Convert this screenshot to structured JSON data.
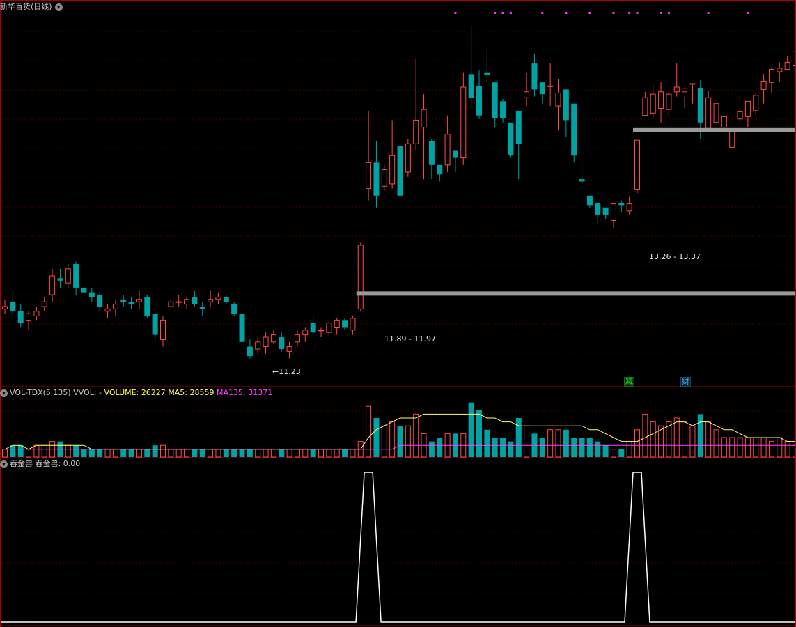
{
  "title": "新华百货(日线)",
  "vol_header": {
    "name": "VOL-TDX(5,135)",
    "vvol": "VVOL: -",
    "volume": "VOLUME: 26227",
    "ma5": "MA5: 28559",
    "ma135": "MA135: 31371"
  },
  "ind_header": {
    "name": "吞金兽",
    "value": "吞金兽: 0.00"
  },
  "annotations": {
    "low": "←11.23",
    "zone1": "11.89 - 11.97",
    "zone2": "13.26 - 13.37",
    "tag_green": "减",
    "tag_blue": "财"
  },
  "colors": {
    "up": "#ff4a4a",
    "down": "#00a3a3",
    "ma5": "#ffff66",
    "ma135": "#ff40ff",
    "indicator": "#ffffff",
    "zone": "#9a9a9a",
    "dots": "#ff33ff",
    "tag_green": "#22dd22",
    "tag_blue": "#33bbff"
  },
  "chart_data": {
    "type": "candlestick",
    "series": [
      {
        "name": "price",
        "ohlc": [
          [
            11.8,
            11.88,
            11.76,
            11.82
          ],
          [
            11.86,
            11.95,
            11.74,
            11.78
          ],
          [
            11.78,
            11.84,
            11.64,
            11.68
          ],
          [
            11.7,
            11.78,
            11.62,
            11.76
          ],
          [
            11.74,
            11.82,
            11.7,
            11.78
          ],
          [
            11.82,
            11.9,
            11.78,
            11.86
          ],
          [
            11.92,
            12.14,
            11.86,
            12.08
          ],
          [
            12.06,
            12.14,
            11.98,
            12.04
          ],
          [
            12.02,
            12.18,
            11.98,
            12.14
          ],
          [
            12.18,
            12.2,
            11.92,
            11.98
          ],
          [
            11.98,
            12.0,
            11.92,
            11.94
          ],
          [
            11.94,
            11.98,
            11.86,
            11.9
          ],
          [
            11.92,
            11.94,
            11.78,
            11.82
          ],
          [
            11.78,
            11.84,
            11.72,
            11.8
          ],
          [
            11.8,
            11.88,
            11.74,
            11.84
          ],
          [
            11.88,
            11.92,
            11.82,
            11.86
          ],
          [
            11.86,
            11.9,
            11.8,
            11.84
          ],
          [
            11.86,
            11.96,
            11.8,
            11.88
          ],
          [
            11.9,
            11.92,
            11.72,
            11.74
          ],
          [
            11.76,
            11.78,
            11.52,
            11.58
          ],
          [
            11.54,
            11.74,
            11.48,
            11.7
          ],
          [
            11.82,
            11.88,
            11.8,
            11.86
          ],
          [
            11.86,
            11.92,
            11.82,
            11.86
          ],
          [
            11.84,
            11.9,
            11.8,
            11.88
          ],
          [
            11.9,
            11.95,
            11.82,
            11.84
          ],
          [
            11.82,
            11.86,
            11.74,
            11.8
          ],
          [
            11.86,
            11.96,
            11.82,
            11.88
          ],
          [
            11.88,
            11.94,
            11.84,
            11.9
          ],
          [
            11.9,
            11.92,
            11.84,
            11.86
          ],
          [
            11.84,
            11.86,
            11.74,
            11.76
          ],
          [
            11.76,
            11.78,
            11.48,
            11.52
          ],
          [
            11.48,
            11.54,
            11.38,
            11.4
          ],
          [
            11.46,
            11.56,
            11.42,
            11.52
          ],
          [
            11.48,
            11.6,
            11.42,
            11.56
          ],
          [
            11.52,
            11.62,
            11.5,
            11.58
          ],
          [
            11.56,
            11.6,
            11.44,
            11.46
          ],
          [
            11.44,
            11.52,
            11.38,
            11.48
          ],
          [
            11.52,
            11.62,
            11.48,
            11.58
          ],
          [
            11.58,
            11.64,
            11.52,
            11.62
          ],
          [
            11.68,
            11.74,
            11.56,
            11.6
          ],
          [
            11.62,
            11.64,
            11.56,
            11.62
          ],
          [
            11.6,
            11.7,
            11.56,
            11.68
          ],
          [
            11.64,
            11.72,
            11.58,
            11.7
          ],
          [
            11.7,
            11.72,
            11.62,
            11.64
          ],
          [
            11.62,
            11.74,
            11.58,
            11.72
          ],
          [
            11.8,
            12.36,
            11.78,
            12.34
          ],
          [
            12.82,
            13.48,
            12.72,
            13.04
          ],
          [
            13.04,
            13.22,
            12.66,
            12.76
          ],
          [
            12.84,
            13.02,
            12.8,
            12.98
          ],
          [
            12.86,
            13.4,
            12.82,
            13.1
          ],
          [
            13.18,
            13.34,
            12.72,
            12.76
          ],
          [
            12.96,
            13.24,
            12.92,
            13.2
          ],
          [
            13.2,
            13.92,
            13.14,
            13.4
          ],
          [
            13.34,
            13.62,
            12.9,
            13.49
          ],
          [
            13.22,
            13.24,
            12.9,
            13.02
          ],
          [
            13.02,
            13.0,
            12.88,
            12.94
          ],
          [
            13.02,
            13.44,
            12.96,
            13.28
          ],
          [
            13.14,
            13.12,
            12.96,
            13.08
          ],
          [
            13.08,
            13.8,
            13.02,
            13.68
          ],
          [
            13.79,
            14.2,
            13.52,
            13.59
          ],
          [
            13.69,
            13.82,
            13.41,
            13.44
          ],
          [
            13.8,
            14.0,
            13.72,
            13.78
          ],
          [
            13.72,
            13.7,
            13.34,
            13.42
          ],
          [
            13.56,
            13.58,
            13.38,
            13.42
          ],
          [
            13.38,
            13.36,
            13.08,
            13.1
          ],
          [
            13.48,
            13.48,
            12.9,
            13.2
          ],
          [
            13.59,
            13.8,
            13.52,
            13.64
          ],
          [
            13.88,
            13.96,
            13.6,
            13.66
          ],
          [
            13.72,
            13.72,
            13.54,
            13.62
          ],
          [
            13.69,
            13.88,
            13.52,
            13.69
          ],
          [
            13.52,
            13.75,
            13.32,
            13.63
          ],
          [
            13.66,
            13.64,
            13.26,
            13.4
          ],
          [
            13.54,
            13.4,
            13.04,
            13.1
          ],
          [
            12.9,
            13.06,
            12.84,
            12.88
          ],
          [
            12.76,
            12.74,
            12.66,
            12.68
          ],
          [
            12.7,
            12.68,
            12.52,
            12.6
          ],
          [
            12.66,
            12.64,
            12.56,
            12.6
          ],
          [
            12.55,
            12.66,
            12.49,
            12.69
          ],
          [
            12.7,
            12.72,
            12.62,
            12.68
          ],
          [
            12.63,
            12.75,
            12.6,
            12.69
          ],
          [
            12.81,
            13.23,
            12.78,
            13.23
          ],
          [
            13.44,
            13.64,
            13.48,
            13.59
          ],
          [
            13.46,
            13.7,
            13.42,
            13.62
          ],
          [
            13.5,
            13.72,
            13.38,
            13.64
          ],
          [
            13.49,
            13.66,
            13.42,
            13.62
          ],
          [
            13.64,
            13.88,
            13.6,
            13.68
          ],
          [
            13.64,
            13.6,
            13.5,
            13.67
          ],
          [
            13.71,
            13.7,
            13.54,
            13.71
          ],
          [
            13.67,
            13.74,
            13.24,
            13.38
          ],
          [
            13.33,
            13.65,
            13.52,
            13.59
          ],
          [
            13.38,
            13.54,
            13.4,
            13.54
          ],
          [
            13.34,
            13.42,
            13.3,
            13.43
          ],
          [
            13.17,
            13.32,
            13.22,
            13.32
          ],
          [
            13.41,
            13.51,
            13.32,
            13.47
          ],
          [
            13.43,
            13.56,
            13.34,
            13.56
          ],
          [
            13.48,
            13.63,
            13.44,
            13.61
          ],
          [
            13.66,
            13.79,
            13.54,
            13.73
          ],
          [
            13.72,
            13.85,
            13.63,
            13.83
          ],
          [
            13.81,
            13.89,
            13.72,
            13.84
          ],
          [
            13.83,
            13.94,
            13.84,
            13.89
          ],
          [
            13.86,
            14.04,
            13.82,
            13.98
          ],
          [
            14.0,
            14.06,
            13.84,
            13.9
          ]
        ]
      }
    ],
    "volume": [
      2,
      3,
      3,
      2,
      3,
      3,
      4,
      4,
      3,
      3,
      2,
      2,
      2,
      2,
      2,
      2,
      2,
      2,
      2,
      3,
      3,
      2,
      2,
      2,
      2,
      2,
      2,
      2,
      2,
      2,
      2,
      2,
      2,
      2,
      2,
      2,
      2,
      2,
      2,
      2,
      2,
      2,
      2,
      2,
      2,
      4,
      13,
      10,
      8,
      9,
      8,
      8,
      11,
      6,
      4,
      5,
      6,
      6,
      6,
      14,
      12,
      7,
      5,
      5,
      4,
      10,
      8,
      6,
      5,
      7,
      7,
      7,
      5,
      5,
      5,
      4,
      3,
      2,
      2,
      4,
      7,
      11,
      9,
      8,
      9,
      10,
      9,
      8,
      11,
      9,
      7,
      5,
      5,
      5,
      5,
      5,
      5,
      4,
      5,
      4,
      3
    ],
    "ma5": [
      2,
      3,
      3,
      2,
      3,
      3,
      3,
      3,
      3,
      3,
      3,
      2,
      2,
      2,
      2,
      2,
      2,
      2,
      2,
      2,
      2,
      2,
      2,
      2,
      2,
      2,
      2,
      2,
      2,
      2,
      2,
      2,
      2,
      2,
      2,
      2,
      2,
      2,
      2,
      2,
      2,
      2,
      2,
      2,
      2,
      2,
      5,
      7,
      8,
      9,
      10,
      10,
      10,
      11,
      11,
      11,
      11,
      11,
      11,
      11,
      11,
      10,
      10,
      9,
      9,
      8,
      8,
      8,
      8,
      8,
      8,
      8,
      8,
      8,
      7,
      7,
      6,
      5,
      4,
      4,
      4,
      5,
      6,
      7,
      8,
      9,
      9,
      8,
      9,
      9,
      8,
      7,
      7,
      6,
      5,
      5,
      5,
      5,
      5,
      4,
      4
    ],
    "ma135": [
      2,
      2,
      2,
      2,
      2,
      2,
      2,
      2,
      2,
      2,
      2,
      2,
      2,
      2,
      2,
      2,
      2,
      2,
      2,
      2,
      2,
      2,
      2,
      2,
      2,
      2,
      2,
      2,
      2,
      2,
      2,
      2,
      2,
      2,
      2,
      2,
      2,
      2,
      2,
      2,
      2,
      2,
      2,
      2,
      2,
      2,
      2,
      2,
      2,
      2,
      3,
      3,
      3,
      3,
      3,
      3,
      3,
      3,
      3,
      3,
      3,
      3,
      3,
      3,
      3,
      3,
      3,
      3,
      3,
      3,
      3,
      3,
      3,
      3,
      3,
      3,
      3,
      3,
      3,
      3,
      3,
      3,
      3,
      3,
      3,
      3,
      3,
      3,
      3,
      3,
      3,
      3,
      3,
      3,
      3,
      3,
      3,
      3,
      3,
      3,
      3
    ],
    "indicator": {
      "name": "吞金兽",
      "spikes_at_candle": [
        46,
        80
      ],
      "value": 0.0
    },
    "signal_dot_candles": [
      57,
      62,
      63,
      64,
      68,
      71,
      74,
      77,
      79,
      80,
      83,
      84,
      89,
      94
    ],
    "price_zones": [
      [
        11.89,
        11.97,
        45
      ],
      [
        13.26,
        13.37,
        80
      ]
    ],
    "ylim_price": [
      11.2,
      14.3
    ]
  }
}
